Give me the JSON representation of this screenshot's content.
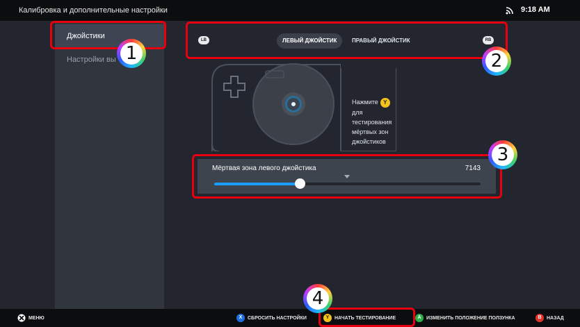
{
  "header": {
    "title": "Калибровка и дополнительные настройки",
    "time": "9:18 AM"
  },
  "sidebar": {
    "items": [
      {
        "label": "Джойстики"
      },
      {
        "label": "Настройки вы"
      }
    ]
  },
  "tabs": {
    "lb": "LB",
    "rb": "RB",
    "left": "ЛЕВЫЙ ДЖОЙСТИК",
    "right": "ПРАВЫЙ ДЖОЙСТИК"
  },
  "hint": {
    "press": "Нажмите",
    "button": "Y",
    "text": "для тестирования мёртвых зон джойстиков"
  },
  "deadzone": {
    "label": "Мёртвая зона левого джойстика",
    "value": "7143",
    "level_fraction": 0.32
  },
  "footer": {
    "menu": "МЕНЮ",
    "reset_key": "X",
    "reset": "СБРОСИТЬ НАСТРОЙКИ",
    "test_key": "Y",
    "test": "НАЧАТЬ ТЕСТИРОВАНИЕ",
    "move_key": "A",
    "move": "ИЗМЕНИТЬ ПОЛОЖЕНИЕ ПОЛЗУНКА",
    "back_key": "B",
    "back": "НАЗАД"
  },
  "annotations": [
    "1",
    "2",
    "3",
    "4"
  ],
  "colors": {
    "accent": "#1a9fff",
    "highlight": "#e8000f",
    "x_button": "#1f6fe0",
    "y_button": "#f4c21b",
    "a_button": "#2bb14a",
    "b_button": "#e0332a"
  }
}
